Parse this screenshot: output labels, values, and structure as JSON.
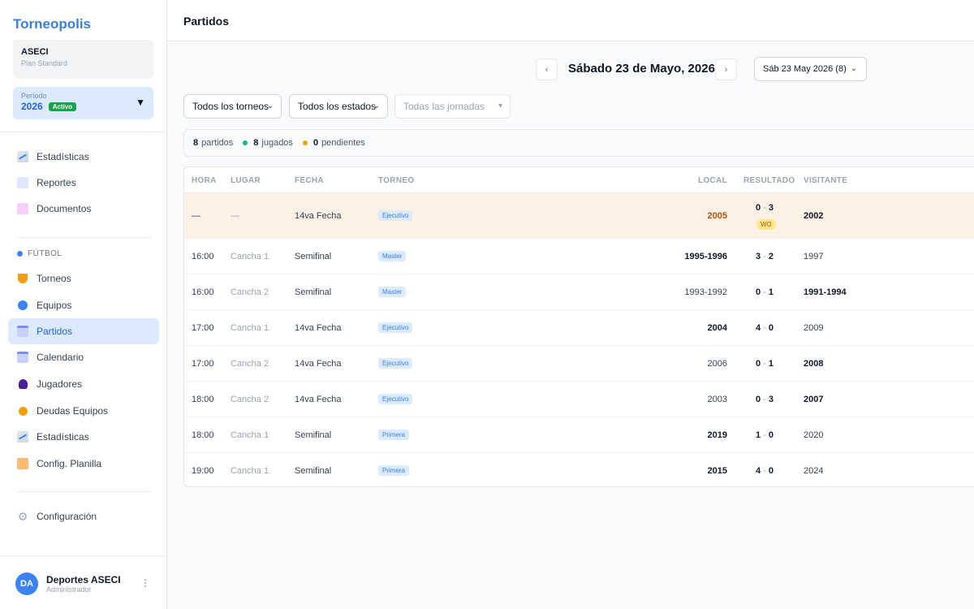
{
  "sidebar": {
    "brand": "Torneopolis",
    "org_name": "ASECI",
    "org_plan": "Plan Standard",
    "period_label": "Período",
    "period_year": "2026",
    "period_status": "Activo",
    "items_top": [
      {
        "label": "Estadísticas",
        "icon": "chart-icon"
      },
      {
        "label": "Reportes",
        "icon": "report-icon"
      },
      {
        "label": "Documentos",
        "icon": "documents-icon"
      }
    ],
    "section_label": "FÚTBOL",
    "items_futbol": [
      {
        "label": "Torneos",
        "icon": "trophy-icon"
      },
      {
        "label": "Equipos",
        "icon": "ball-icon"
      },
      {
        "label": "Partidos",
        "icon": "calendar-icon"
      },
      {
        "label": "Calendario",
        "icon": "calendar-icon"
      },
      {
        "label": "Jugadores",
        "icon": "user-icon"
      },
      {
        "label": "Deudas Equipos",
        "icon": "money-bag-icon"
      },
      {
        "label": "Estadísticas",
        "icon": "chart-icon"
      },
      {
        "label": "Config. Planilla",
        "icon": "edit-icon"
      }
    ],
    "settings_label": "Configuración",
    "user_initials": "DA",
    "user_name": "Deportes ASECI",
    "user_role": "Administrador"
  },
  "header": {
    "title": "Partidos"
  },
  "date_nav": {
    "prev": "‹",
    "next": "›",
    "title": "Sábado 23 de Mayo, 2026",
    "select_value": "Sáb 23 May 2026 (8)"
  },
  "filters": {
    "torneos": "Todos los torneos",
    "estados": "Todos los estados",
    "jornadas": "Todas las jornadas"
  },
  "summary": {
    "partidos_count": "8",
    "partidos_label": "partidos",
    "jugados_count": "8",
    "jugados_label": "jugados",
    "pendientes_count": "0",
    "pendientes_label": "pendientes",
    "jugados_color": "#10b981",
    "pendientes_color": "#f59e0b"
  },
  "table": {
    "headers": {
      "hora": "HORA",
      "lugar": "LUGAR",
      "fecha": "FECHA",
      "torneo": "TORNEO",
      "local": "LOCAL",
      "resultado": "RESULTADO",
      "visitante": "VISITANTE"
    },
    "rows": [
      {
        "hora": "—",
        "lugar": "—",
        "fecha": "14va Fecha",
        "torneo": "Ejecutivo",
        "local": "2005",
        "goles_local": "0",
        "goles_visitante": "3",
        "visitante": "2002",
        "badge": "WO"
      },
      {
        "hora": "16:00",
        "lugar": "Cancha 1",
        "fecha": "Semifinal",
        "torneo": "Master",
        "local": "1995-1996",
        "goles_local": "3",
        "goles_visitante": "2",
        "visitante": "1997"
      },
      {
        "hora": "16:00",
        "lugar": "Cancha 2",
        "fecha": "Semifinal",
        "torneo": "Master",
        "local": "1993-1992",
        "goles_local": "0",
        "goles_visitante": "1",
        "visitante": "1991-1994"
      },
      {
        "hora": "17:00",
        "lugar": "Cancha 1",
        "fecha": "14va Fecha",
        "torneo": "Ejecutivo",
        "local": "2004",
        "goles_local": "4",
        "goles_visitante": "0",
        "visitante": "2009"
      },
      {
        "hora": "17:00",
        "lugar": "Cancha 2",
        "fecha": "14va Fecha",
        "torneo": "Ejecutivo",
        "local": "2006",
        "goles_local": "0",
        "goles_visitante": "1",
        "visitante": "2008"
      },
      {
        "hora": "18:00",
        "lugar": "Cancha 2",
        "fecha": "14va Fecha",
        "torneo": "Ejecutivo",
        "local": "2003",
        "goles_local": "0",
        "goles_visitante": "3",
        "visitante": "2007"
      },
      {
        "hora": "18:00",
        "lugar": "Cancha 1",
        "fecha": "Semifinal",
        "torneo": "Primera",
        "local": "2019",
        "goles_local": "1",
        "goles_visitante": "0",
        "visitante": "2020"
      },
      {
        "hora": "19:00",
        "lugar": "Cancha 1",
        "fecha": "Semifinal",
        "torneo": "Primera",
        "local": "2015",
        "goles_local": "4",
        "goles_visitante": "0",
        "visitante": "2024"
      }
    ]
  }
}
